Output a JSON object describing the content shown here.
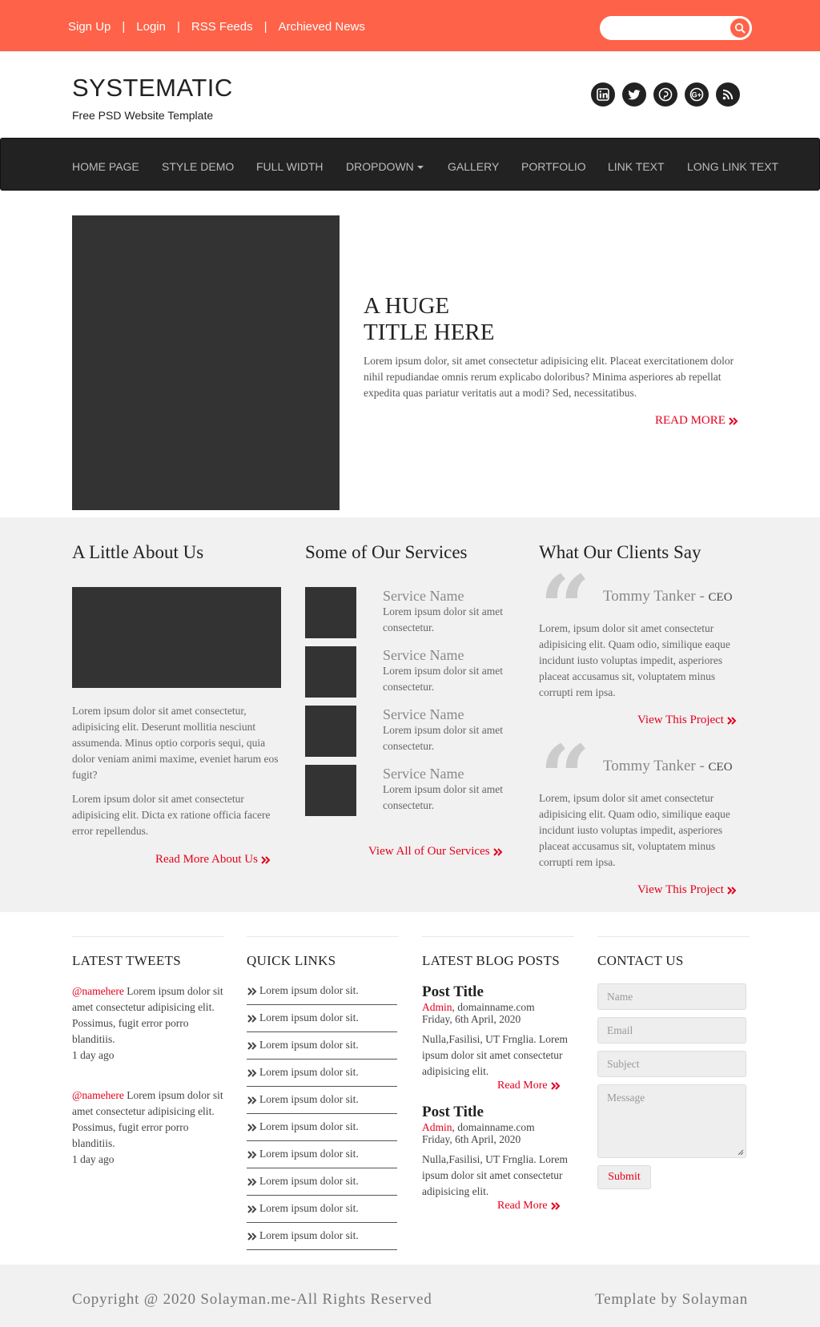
{
  "topbar": {
    "links": [
      "Sign Up",
      "Login",
      "RSS Feeds",
      "Archieved News"
    ],
    "separator": "|",
    "search_placeholder": "",
    "accent_color": "#fe6248"
  },
  "header": {
    "brand": "SYSTEMATIC",
    "tagline": "Free PSD Website Template",
    "social_icons": [
      "linkedin-icon",
      "twitter-icon",
      "pinterest-icon",
      "google-plus-icon",
      "rss-icon"
    ]
  },
  "nav": {
    "items": [
      "HOME PAGE",
      "STYLE DEMO",
      "FULL WIDTH",
      "DROPDOWN",
      "GALLERY",
      "PORTFOLIO",
      "LINK TEXT",
      "LONG LINK TEXT"
    ]
  },
  "hero": {
    "title_line1": "A HUGE",
    "title_line2": "TITLE HERE",
    "text": "Lorem ipsum dolor, sit amet consectetur adipisicing elit. Placeat exercitationem dolor nihil repudiandae omnis rerum explicabo doloribus? Minima asperiores ab repellat expedita quas pariatur veritatis aut a modi? Sed, necessitatibus.",
    "read_more": "READ MORE"
  },
  "about": {
    "title": "A Little About Us",
    "para1": "Lorem ipsum dolor sit amet consectetur, adipisicing elit. Deserunt mollitia nesciunt assumenda. Minus optio corporis sequi, quia dolor veniam animi maxime, eveniet harum eos fugit?",
    "para2": "Lorem ipsum dolor sit amet consectetur adipisicing elit. Dicta ex ratione officia facere error repellendus.",
    "link": "Read More About Us"
  },
  "services": {
    "title": "Some of Our Services",
    "items": [
      {
        "name": "Service Name",
        "desc": "Lorem ipsum dolor sit amet consectetur."
      },
      {
        "name": "Service Name",
        "desc": "Lorem ipsum dolor sit amet consectetur."
      },
      {
        "name": "Service Name",
        "desc": "Lorem ipsum dolor sit amet consectetur."
      },
      {
        "name": "Service Name",
        "desc": "Lorem ipsum dolor sit amet consectetur."
      }
    ],
    "link": "View All of Our Services"
  },
  "clients": {
    "title": "What Our Clients Say",
    "items": [
      {
        "name": "Tommy Tanker - ",
        "role": "CEO",
        "text": "Lorem, ipsum dolor sit amet consectetur adipisicing elit. Quam odio, similique eaque incidunt iusto voluptas impedit, asperiores placeat accusamus sit, voluptatem minus corrupti rem ipsa.",
        "link": "View This Project"
      },
      {
        "name": "Tommy Tanker - ",
        "role": "CEO",
        "text": "Lorem, ipsum dolor sit amet consectetur adipisicing elit. Quam odio, similique eaque incidunt iusto voluptas impedit, asperiores placeat accusamus sit, voluptatem minus corrupti rem ipsa.",
        "link": "View This Project"
      }
    ]
  },
  "footer": {
    "tweets": {
      "title": "LATEST TWEETS",
      "items": [
        {
          "handle": "@namehere",
          "text": " Lorem ipsum dolor sit amet consectetur adipisicing elit. Possimus, fugit error porro blanditiis.",
          "time": "1 day ago"
        },
        {
          "handle": "@namehere",
          "text": " Lorem ipsum dolor sit amet consectetur adipisicing elit. Possimus, fugit error porro blanditiis.",
          "time": "1 day ago"
        }
      ]
    },
    "quick_links": {
      "title": "QUICK LINKS",
      "items": [
        "Lorem ipsum dolor sit.",
        "Lorem ipsum dolor sit.",
        "Lorem ipsum dolor sit.",
        "Lorem ipsum dolor sit.",
        "Lorem ipsum dolor sit.",
        "Lorem ipsum dolor sit.",
        "Lorem ipsum dolor sit.",
        "Lorem ipsum dolor sit.",
        "Lorem ipsum dolor sit.",
        "Lorem ipsum dolor sit."
      ]
    },
    "blog": {
      "title": "LATEST BLOG POSTS",
      "posts": [
        {
          "title": "Post Title",
          "author": "Admin",
          "domain": ", domainname.com",
          "date": "Friday, 6th April, 2020",
          "body": "Nulla,Fasilisi, UT Frnglia. Lorem ipsum dolor sit amet consectetur adipisicing elit.",
          "link": "Read More"
        },
        {
          "title": "Post Title",
          "author": "Admin",
          "domain": ", domainname.com",
          "date": "Friday, 6th April, 2020",
          "body": "Nulla,Fasilisi, UT Frnglia. Lorem ipsum dolor sit amet consectetur adipisicing elit.",
          "link": "Read More"
        }
      ]
    },
    "contact": {
      "title": "CONTACT US",
      "name_placeholder": "Name",
      "email_placeholder": "Email",
      "subject_placeholder": "Subject",
      "message_placeholder": "Message",
      "submit": "Submit"
    }
  },
  "copyright": {
    "left": "Copyright @ 2020 Solayman.me-All Rights Reserved",
    "right": "Template by Solayman"
  },
  "colors": {
    "accent": "#fe6248",
    "link_red": "#e3001b",
    "nav_bg": "#222222",
    "band_gray": "#f1f1f1"
  }
}
